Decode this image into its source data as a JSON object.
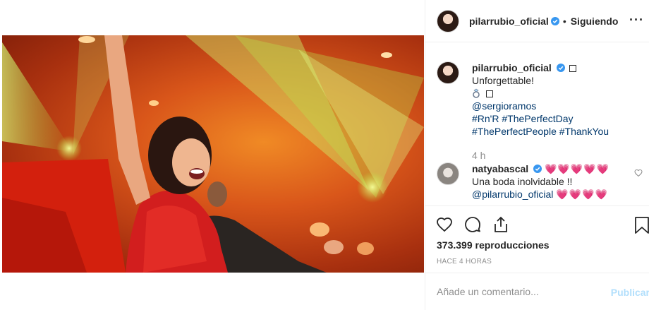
{
  "header": {
    "username": "pilarrubio_oficial",
    "separator": "•",
    "follow_state": "Siguiendo",
    "more_label": "···"
  },
  "caption": {
    "username": "pilarrubio_oficial",
    "text_line1": "Unforgettable!",
    "mention": "@sergioramos",
    "hashtags_line1": "#Rn'R #ThePerfectDay",
    "hashtags_line2": "#ThePerfectPeople #ThankYou",
    "time": "4 h"
  },
  "comments": [
    {
      "username": "natyabascal",
      "hearts": "💗💗💗💗💗",
      "text": "Una boda inolvidable !!",
      "mention": "@pilarrubio_oficial",
      "trailing_hearts": "💗💗💗💗"
    }
  ],
  "stats": {
    "views": "373.399 reproducciones",
    "posted": "HACE 4 HORAS"
  },
  "composer": {
    "placeholder": "Añade un comentario...",
    "publish_label": "Publicar"
  },
  "colors": {
    "accent": "#0095f6",
    "publish_disabled": "#b2dffc",
    "link": "#00376b",
    "verified": "#3897f0",
    "muted": "#8e8e8e"
  },
  "icons": {
    "verified": "verified-badge-icon",
    "ring": "ring-icon",
    "like": "heart-icon",
    "comment": "comment-bubble-icon",
    "share": "share-icon",
    "save": "bookmark-icon",
    "user": "user-icon"
  }
}
